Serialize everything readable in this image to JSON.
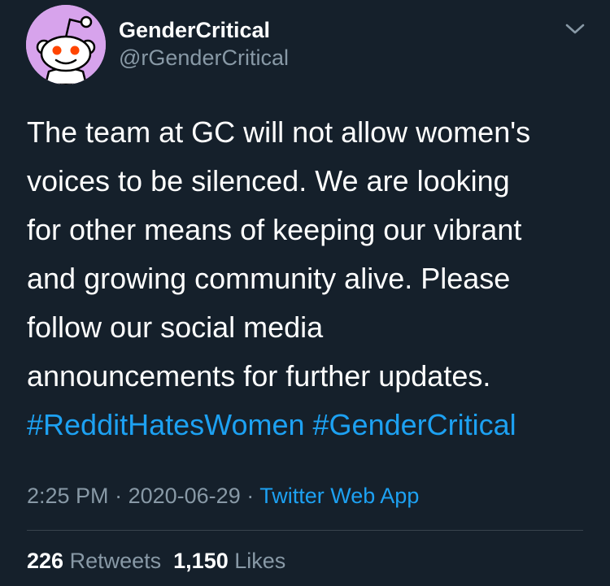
{
  "user": {
    "name": "GenderCritical",
    "handle": "@rGenderCritical"
  },
  "tweet": {
    "lines": [
      "The team at GC will not allow women's",
      "voices to be silenced. We are looking",
      "for other means of keeping our vibrant",
      "and growing community alive. Please",
      "follow our social media",
      "announcements for further updates."
    ],
    "hashtags": [
      "#RedditHatesWomen",
      "#GenderCritical"
    ]
  },
  "meta": {
    "time": "2:25 PM",
    "separator": "·",
    "date": "2020-06-29",
    "source": "Twitter Web App"
  },
  "stats": {
    "retweets_count": "226",
    "retweets_label": "Retweets",
    "likes_count": "1,150",
    "likes_label": "Likes"
  },
  "icons": {
    "avatar": "reddit-snoo-icon",
    "menu": "chevron-down-icon"
  },
  "colors": {
    "background": "#15202b",
    "accent": "#1da1f2",
    "secondary_text": "#8899a6",
    "avatar_bg": "#d7a3ec"
  }
}
